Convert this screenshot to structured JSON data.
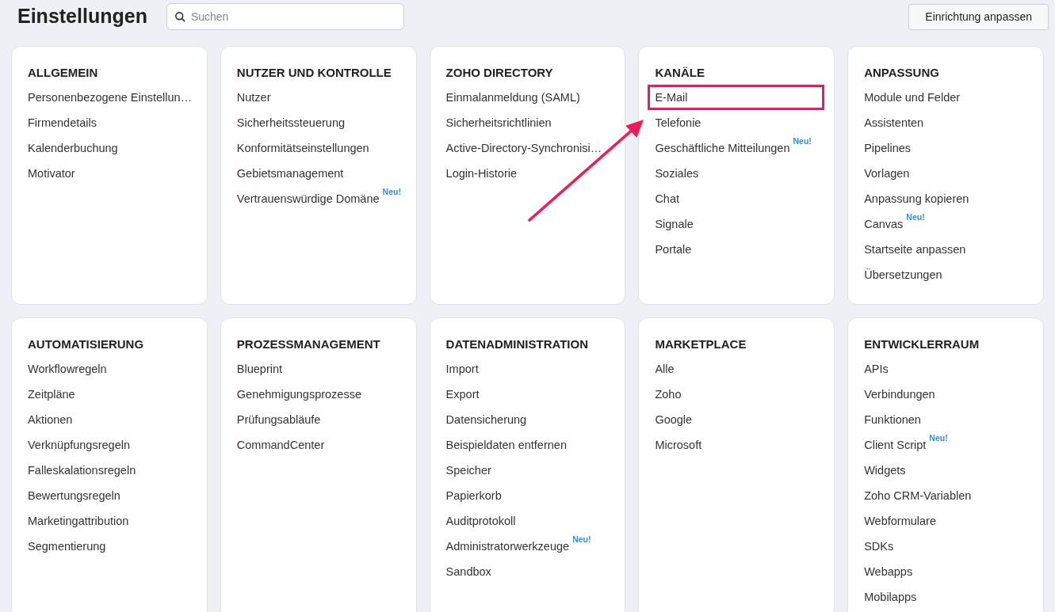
{
  "header": {
    "title": "Einstellungen",
    "search": {
      "placeholder": "Suchen"
    },
    "button": "Einrichtung anpassen"
  },
  "sections": [
    {
      "title": "ALLGEMEIN",
      "items": [
        {
          "label": "Personenbezogene Einstellun…",
          "highlighted": false
        },
        {
          "label": "Firmendetails",
          "highlighted": false
        },
        {
          "label": "Kalenderbuchung",
          "highlighted": false
        },
        {
          "label": "Motivator",
          "highlighted": false
        }
      ]
    },
    {
      "title": "NUTZER UND KONTROLLE",
      "items": [
        {
          "label": "Nutzer",
          "highlighted": false
        },
        {
          "label": "Sicherheitssteuerung",
          "highlighted": false
        },
        {
          "label": "Konformitätseinstellungen",
          "highlighted": false
        },
        {
          "label": "Gebietsmanagement",
          "highlighted": false
        },
        {
          "label": "Vertrauenswürdige Domäne",
          "badge": "Neu!",
          "highlighted": false
        }
      ]
    },
    {
      "title": "ZOHO DIRECTORY",
      "items": [
        {
          "label": "Einmalanmeldung (SAML)",
          "highlighted": false
        },
        {
          "label": "Sicherheitsrichtlinien",
          "highlighted": false
        },
        {
          "label": "Active-Directory-Synchronisi…",
          "highlighted": false
        },
        {
          "label": "Login-Historie",
          "highlighted": false
        }
      ]
    },
    {
      "title": "KANÄLE",
      "items": [
        {
          "label": "E-Mail",
          "highlighted": true
        },
        {
          "label": "Telefonie",
          "highlighted": false
        },
        {
          "label": "Geschäftliche Mitteilungen",
          "badge": "Neu!",
          "highlighted": false
        },
        {
          "label": "Soziales",
          "highlighted": false
        },
        {
          "label": "Chat",
          "highlighted": false
        },
        {
          "label": "Signale",
          "highlighted": false
        },
        {
          "label": "Portale",
          "highlighted": false
        }
      ]
    },
    {
      "title": "ANPASSUNG",
      "items": [
        {
          "label": "Module und Felder",
          "highlighted": false
        },
        {
          "label": "Assistenten",
          "highlighted": false
        },
        {
          "label": "Pipelines",
          "highlighted": false
        },
        {
          "label": "Vorlagen",
          "highlighted": false
        },
        {
          "label": "Anpassung kopieren",
          "highlighted": false
        },
        {
          "label": "Canvas",
          "badge": "Neu!",
          "highlighted": false
        },
        {
          "label": "Startseite anpassen",
          "highlighted": false
        },
        {
          "label": "Übersetzungen",
          "highlighted": false
        }
      ]
    },
    {
      "title": "AUTOMATISIERUNG",
      "items": [
        {
          "label": "Workflowregeln",
          "highlighted": false
        },
        {
          "label": "Zeitpläne",
          "highlighted": false
        },
        {
          "label": "Aktionen",
          "highlighted": false
        },
        {
          "label": "Verknüpfungsregeln",
          "highlighted": false
        },
        {
          "label": "Falleskalationsregeln",
          "highlighted": false
        },
        {
          "label": "Bewertungsregeln",
          "highlighted": false
        },
        {
          "label": "Marketingattribution",
          "highlighted": false
        },
        {
          "label": "Segmentierung",
          "highlighted": false
        }
      ]
    },
    {
      "title": "PROZESSMANAGEMENT",
      "items": [
        {
          "label": "Blueprint",
          "highlighted": false
        },
        {
          "label": "Genehmigungsprozesse",
          "highlighted": false
        },
        {
          "label": "Prüfungsabläufe",
          "highlighted": false
        },
        {
          "label": "CommandCenter",
          "highlighted": false
        }
      ]
    },
    {
      "title": "DATENADMINISTRATION",
      "items": [
        {
          "label": "Import",
          "highlighted": false
        },
        {
          "label": "Export",
          "highlighted": false
        },
        {
          "label": "Datensicherung",
          "highlighted": false
        },
        {
          "label": "Beispieldaten entfernen",
          "highlighted": false
        },
        {
          "label": "Speicher",
          "highlighted": false
        },
        {
          "label": "Papierkorb",
          "highlighted": false
        },
        {
          "label": "Auditprotokoll",
          "highlighted": false
        },
        {
          "label": "Administratorwerkzeuge",
          "badge": "Neu!",
          "highlighted": false
        },
        {
          "label": "Sandbox",
          "highlighted": false
        }
      ]
    },
    {
      "title": "MARKETPLACE",
      "items": [
        {
          "label": "Alle",
          "highlighted": false
        },
        {
          "label": "Zoho",
          "highlighted": false
        },
        {
          "label": "Google",
          "highlighted": false
        },
        {
          "label": "Microsoft",
          "highlighted": false
        }
      ]
    },
    {
      "title": "ENTWICKLERRAUM",
      "items": [
        {
          "label": "APIs",
          "highlighted": false
        },
        {
          "label": "Verbindungen",
          "highlighted": false
        },
        {
          "label": "Funktionen",
          "highlighted": false
        },
        {
          "label": "Client Script",
          "badge": "Neu!",
          "highlighted": false
        },
        {
          "label": "Widgets",
          "highlighted": false
        },
        {
          "label": "Zoho CRM-Variablen",
          "highlighted": false
        },
        {
          "label": "Webformulare",
          "highlighted": false
        },
        {
          "label": "SDKs",
          "highlighted": false
        },
        {
          "label": "Webapps",
          "highlighted": false
        },
        {
          "label": "Mobilapps",
          "highlighted": false
        }
      ]
    }
  ]
}
